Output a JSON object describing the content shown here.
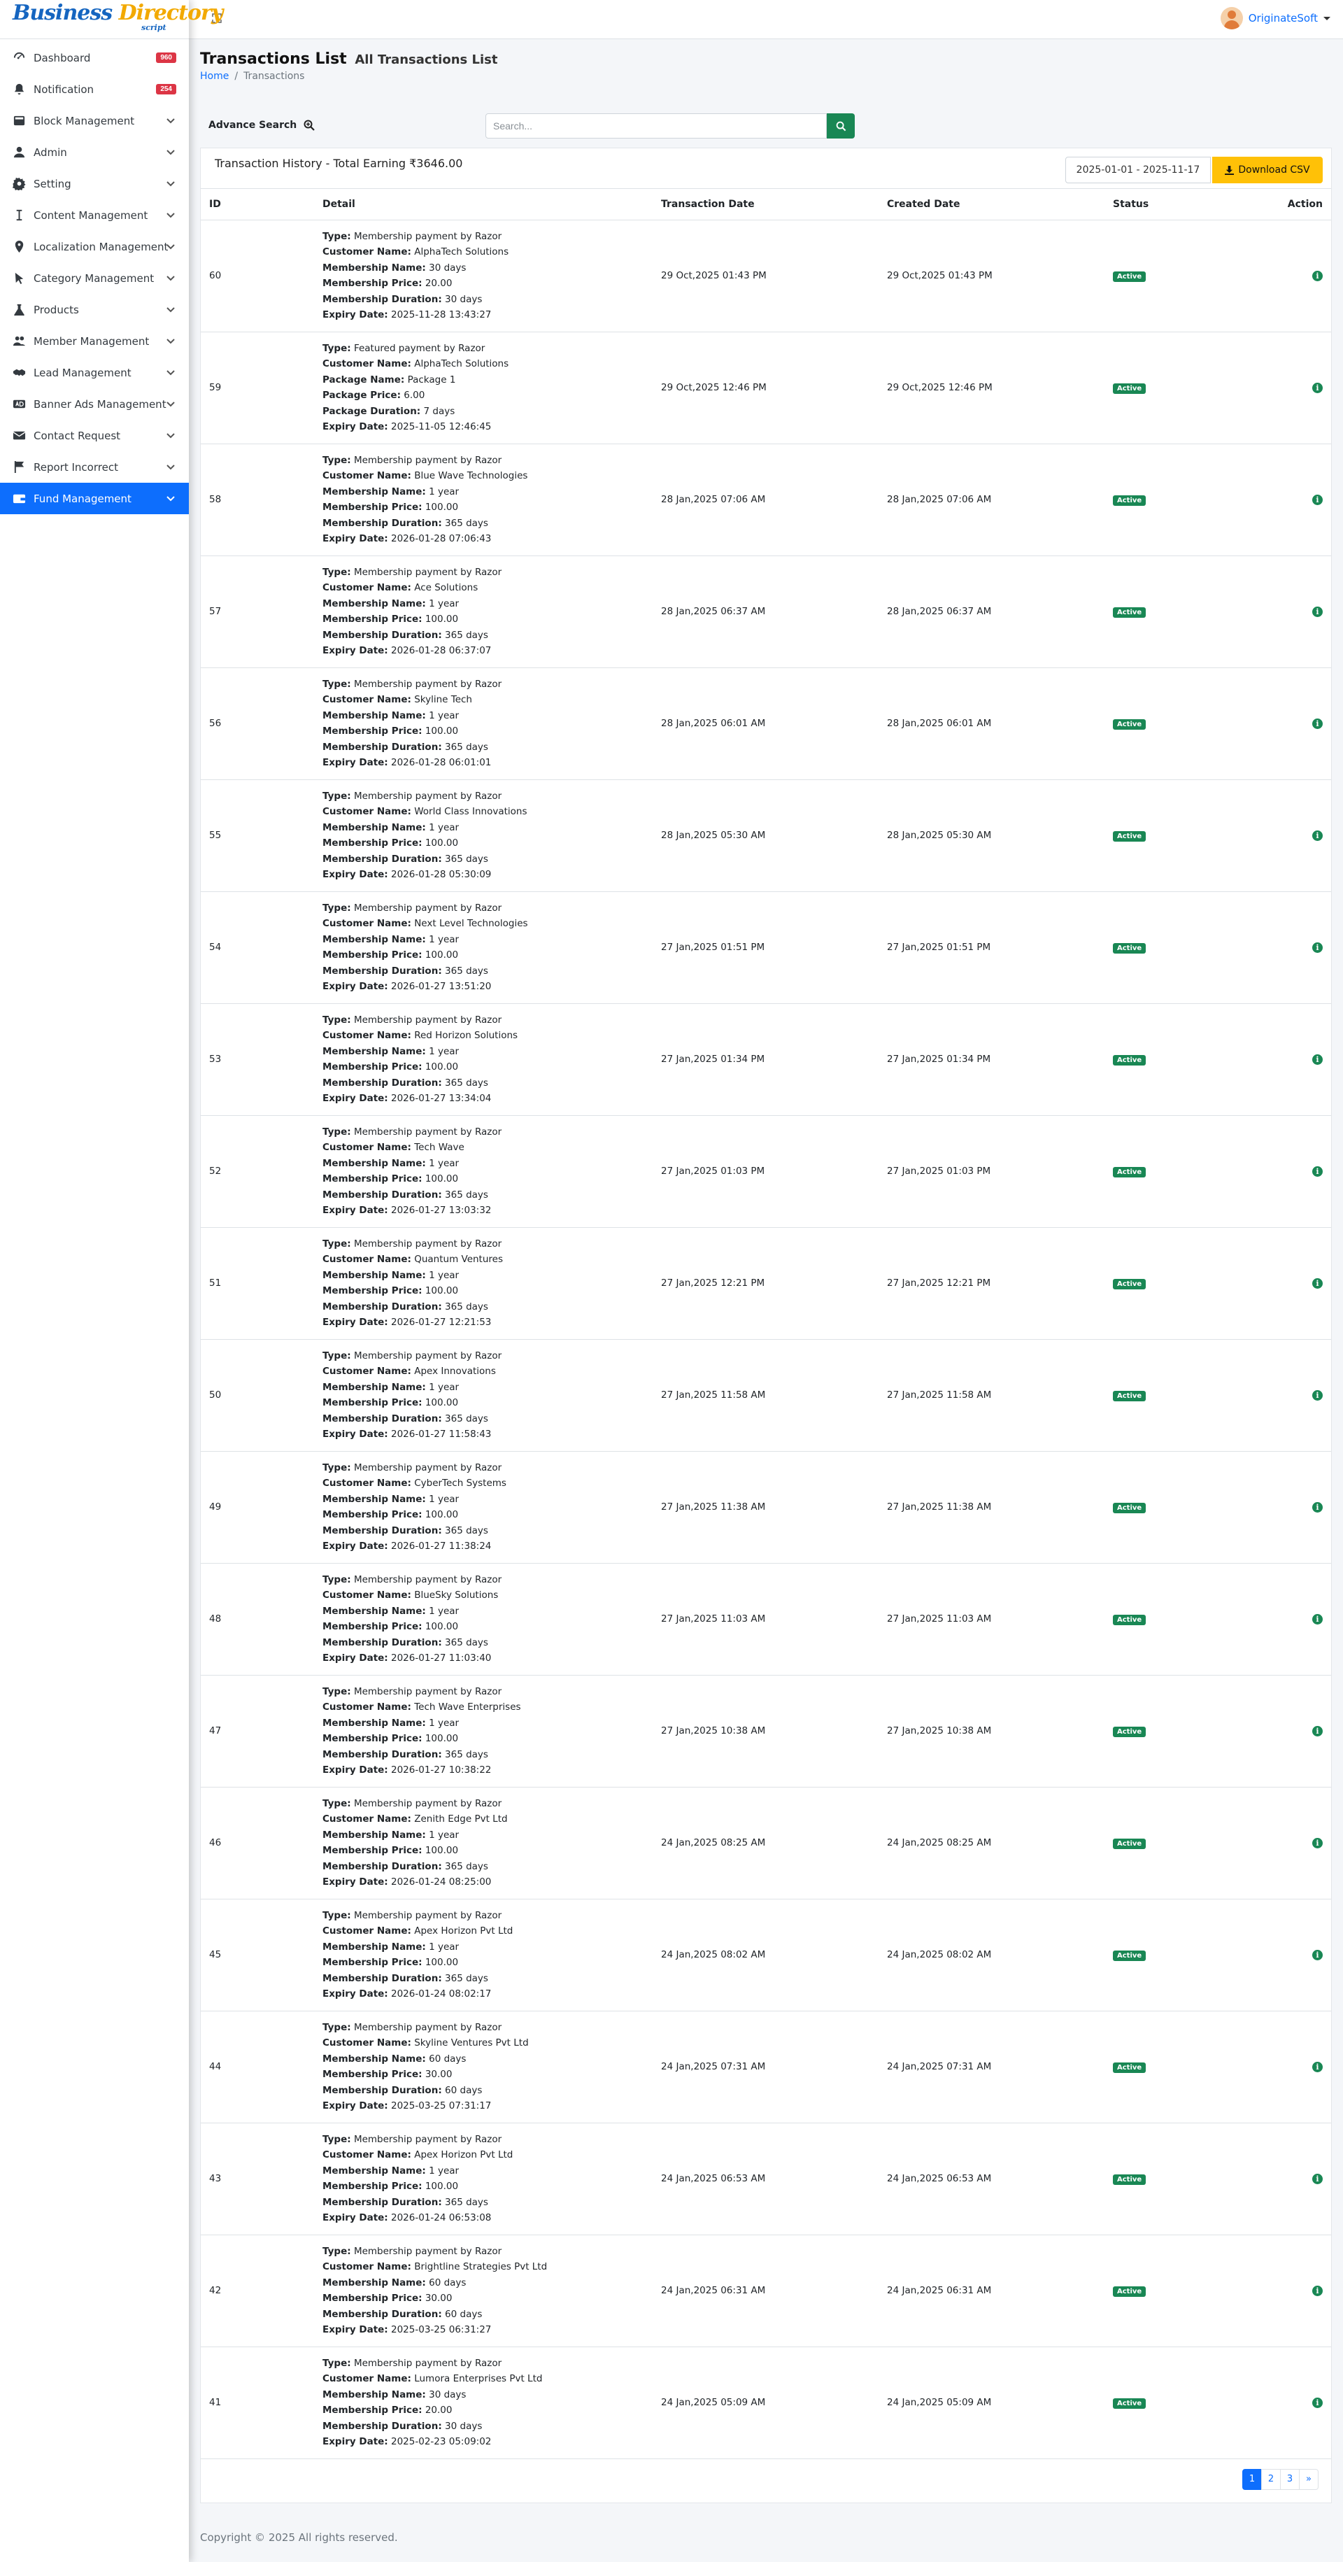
{
  "brand": {
    "word1": "Business",
    "word2": "Directory",
    "tag": "script"
  },
  "sidebar": {
    "items": [
      {
        "label": "Dashboard",
        "icon": "dashboard-icon",
        "badge": "960"
      },
      {
        "label": "Notification",
        "icon": "bell-icon",
        "badge": "254"
      },
      {
        "label": "Block Management",
        "icon": "block-icon"
      },
      {
        "label": "Admin",
        "icon": "user-icon"
      },
      {
        "label": "Setting",
        "icon": "gear-icon"
      },
      {
        "label": "Content Management",
        "icon": "text-cursor-icon"
      },
      {
        "label": "Localization Management",
        "icon": "map-pin-icon"
      },
      {
        "label": "Category Management",
        "icon": "cursor-icon"
      },
      {
        "label": "Products",
        "icon": "flask-icon"
      },
      {
        "label": "Member Management",
        "icon": "users-icon"
      },
      {
        "label": "Lead Management",
        "icon": "handshake-icon"
      },
      {
        "label": "Banner Ads Management",
        "icon": "ad-icon"
      },
      {
        "label": "Contact Request",
        "icon": "envelope-icon"
      },
      {
        "label": "Report Incorrect",
        "icon": "flag-icon"
      },
      {
        "label": "Fund Management",
        "icon": "wallet-icon",
        "active": true
      }
    ]
  },
  "topbar": {
    "username": "OriginateSoft"
  },
  "page": {
    "title": "Transactions List",
    "subtitle": "All Transactions List",
    "crumb_home": "Home",
    "crumb_sep": "/",
    "crumb_current": "Transactions"
  },
  "search": {
    "advance_label": "Advance Search",
    "placeholder": "Search..."
  },
  "card": {
    "heading": "Transaction History - Total Earning ₹3646.00",
    "date_range": "2025-01-01 - 2025-11-17",
    "download_label": "Download CSV"
  },
  "table": {
    "headers": [
      "ID",
      "Detail",
      "Transaction Date",
      "Created Date",
      "Status",
      "Action"
    ],
    "rows": [
      {
        "id": "60",
        "lines": [
          [
            "Type:",
            "Membership payment by Razor"
          ],
          [
            "Customer Name:",
            "AlphaTech Solutions"
          ],
          [
            "Membership Name:",
            "30 days"
          ],
          [
            "Membership Price:",
            "20.00"
          ],
          [
            "Membership Duration:",
            "30 days"
          ],
          [
            "Expiry Date:",
            "2025-11-28 13:43:27"
          ]
        ],
        "txn": "29 Oct,2025 01:43 PM",
        "created": "29 Oct,2025 01:43 PM",
        "status": "Active"
      },
      {
        "id": "59",
        "lines": [
          [
            "Type:",
            "Featured payment by Razor"
          ],
          [
            "Customer Name:",
            "AlphaTech Solutions"
          ],
          [
            "Package Name:",
            "Package 1"
          ],
          [
            "Package Price:",
            "6.00"
          ],
          [
            "Package Duration:",
            "7 days"
          ],
          [
            "Expiry Date:",
            "2025-11-05 12:46:45"
          ]
        ],
        "txn": "29 Oct,2025 12:46 PM",
        "created": "29 Oct,2025 12:46 PM",
        "status": "Active"
      },
      {
        "id": "58",
        "lines": [
          [
            "Type:",
            "Membership payment by Razor"
          ],
          [
            "Customer Name:",
            "Blue Wave Technologies"
          ],
          [
            "Membership Name:",
            "1 year"
          ],
          [
            "Membership Price:",
            "100.00"
          ],
          [
            "Membership Duration:",
            "365 days"
          ],
          [
            "Expiry Date:",
            "2026-01-28 07:06:43"
          ]
        ],
        "txn": "28 Jan,2025 07:06 AM",
        "created": "28 Jan,2025 07:06 AM",
        "status": "Active"
      },
      {
        "id": "57",
        "lines": [
          [
            "Type:",
            "Membership payment by Razor"
          ],
          [
            "Customer Name:",
            "Ace Solutions"
          ],
          [
            "Membership Name:",
            "1 year"
          ],
          [
            "Membership Price:",
            "100.00"
          ],
          [
            "Membership Duration:",
            "365 days"
          ],
          [
            "Expiry Date:",
            "2026-01-28 06:37:07"
          ]
        ],
        "txn": "28 Jan,2025 06:37 AM",
        "created": "28 Jan,2025 06:37 AM",
        "status": "Active"
      },
      {
        "id": "56",
        "lines": [
          [
            "Type:",
            "Membership payment by Razor"
          ],
          [
            "Customer Name:",
            "Skyline Tech"
          ],
          [
            "Membership Name:",
            "1 year"
          ],
          [
            "Membership Price:",
            "100.00"
          ],
          [
            "Membership Duration:",
            "365 days"
          ],
          [
            "Expiry Date:",
            "2026-01-28 06:01:01"
          ]
        ],
        "txn": "28 Jan,2025 06:01 AM",
        "created": "28 Jan,2025 06:01 AM",
        "status": "Active"
      },
      {
        "id": "55",
        "lines": [
          [
            "Type:",
            "Membership payment by Razor"
          ],
          [
            "Customer Name:",
            "World Class Innovations"
          ],
          [
            "Membership Name:",
            "1 year"
          ],
          [
            "Membership Price:",
            "100.00"
          ],
          [
            "Membership Duration:",
            "365 days"
          ],
          [
            "Expiry Date:",
            "2026-01-28 05:30:09"
          ]
        ],
        "txn": "28 Jan,2025 05:30 AM",
        "created": "28 Jan,2025 05:30 AM",
        "status": "Active"
      },
      {
        "id": "54",
        "lines": [
          [
            "Type:",
            "Membership payment by Razor"
          ],
          [
            "Customer Name:",
            "Next Level Technologies"
          ],
          [
            "Membership Name:",
            "1 year"
          ],
          [
            "Membership Price:",
            "100.00"
          ],
          [
            "Membership Duration:",
            "365 days"
          ],
          [
            "Expiry Date:",
            "2026-01-27 13:51:20"
          ]
        ],
        "txn": "27 Jan,2025 01:51 PM",
        "created": "27 Jan,2025 01:51 PM",
        "status": "Active"
      },
      {
        "id": "53",
        "lines": [
          [
            "Type:",
            "Membership payment by Razor"
          ],
          [
            "Customer Name:",
            "Red Horizon Solutions"
          ],
          [
            "Membership Name:",
            "1 year"
          ],
          [
            "Membership Price:",
            "100.00"
          ],
          [
            "Membership Duration:",
            "365 days"
          ],
          [
            "Expiry Date:",
            "2026-01-27 13:34:04"
          ]
        ],
        "txn": "27 Jan,2025 01:34 PM",
        "created": "27 Jan,2025 01:34 PM",
        "status": "Active"
      },
      {
        "id": "52",
        "lines": [
          [
            "Type:",
            "Membership payment by Razor"
          ],
          [
            "Customer Name:",
            "Tech Wave"
          ],
          [
            "Membership Name:",
            "1 year"
          ],
          [
            "Membership Price:",
            "100.00"
          ],
          [
            "Membership Duration:",
            "365 days"
          ],
          [
            "Expiry Date:",
            "2026-01-27 13:03:32"
          ]
        ],
        "txn": "27 Jan,2025 01:03 PM",
        "created": "27 Jan,2025 01:03 PM",
        "status": "Active"
      },
      {
        "id": "51",
        "lines": [
          [
            "Type:",
            "Membership payment by Razor"
          ],
          [
            "Customer Name:",
            "Quantum Ventures"
          ],
          [
            "Membership Name:",
            "1 year"
          ],
          [
            "Membership Price:",
            "100.00"
          ],
          [
            "Membership Duration:",
            "365 days"
          ],
          [
            "Expiry Date:",
            "2026-01-27 12:21:53"
          ]
        ],
        "txn": "27 Jan,2025 12:21 PM",
        "created": "27 Jan,2025 12:21 PM",
        "status": "Active"
      },
      {
        "id": "50",
        "lines": [
          [
            "Type:",
            "Membership payment by Razor"
          ],
          [
            "Customer Name:",
            "Apex Innovations"
          ],
          [
            "Membership Name:",
            "1 year"
          ],
          [
            "Membership Price:",
            "100.00"
          ],
          [
            "Membership Duration:",
            "365 days"
          ],
          [
            "Expiry Date:",
            "2026-01-27 11:58:43"
          ]
        ],
        "txn": "27 Jan,2025 11:58 AM",
        "created": "27 Jan,2025 11:58 AM",
        "status": "Active"
      },
      {
        "id": "49",
        "lines": [
          [
            "Type:",
            "Membership payment by Razor"
          ],
          [
            "Customer Name:",
            "CyberTech Systems"
          ],
          [
            "Membership Name:",
            "1 year"
          ],
          [
            "Membership Price:",
            "100.00"
          ],
          [
            "Membership Duration:",
            "365 days"
          ],
          [
            "Expiry Date:",
            "2026-01-27 11:38:24"
          ]
        ],
        "txn": "27 Jan,2025 11:38 AM",
        "created": "27 Jan,2025 11:38 AM",
        "status": "Active"
      },
      {
        "id": "48",
        "lines": [
          [
            "Type:",
            "Membership payment by Razor"
          ],
          [
            "Customer Name:",
            "BlueSky Solutions"
          ],
          [
            "Membership Name:",
            "1 year"
          ],
          [
            "Membership Price:",
            "100.00"
          ],
          [
            "Membership Duration:",
            "365 days"
          ],
          [
            "Expiry Date:",
            "2026-01-27 11:03:40"
          ]
        ],
        "txn": "27 Jan,2025 11:03 AM",
        "created": "27 Jan,2025 11:03 AM",
        "status": "Active"
      },
      {
        "id": "47",
        "lines": [
          [
            "Type:",
            "Membership payment by Razor"
          ],
          [
            "Customer Name:",
            "Tech Wave Enterprises"
          ],
          [
            "Membership Name:",
            "1 year"
          ],
          [
            "Membership Price:",
            "100.00"
          ],
          [
            "Membership Duration:",
            "365 days"
          ],
          [
            "Expiry Date:",
            "2026-01-27 10:38:22"
          ]
        ],
        "txn": "27 Jan,2025 10:38 AM",
        "created": "27 Jan,2025 10:38 AM",
        "status": "Active"
      },
      {
        "id": "46",
        "lines": [
          [
            "Type:",
            "Membership payment by Razor"
          ],
          [
            "Customer Name:",
            "Zenith Edge Pvt Ltd"
          ],
          [
            "Membership Name:",
            "1 year"
          ],
          [
            "Membership Price:",
            "100.00"
          ],
          [
            "Membership Duration:",
            "365 days"
          ],
          [
            "Expiry Date:",
            "2026-01-24 08:25:00"
          ]
        ],
        "txn": "24 Jan,2025 08:25 AM",
        "created": "24 Jan,2025 08:25 AM",
        "status": "Active"
      },
      {
        "id": "45",
        "lines": [
          [
            "Type:",
            "Membership payment by Razor"
          ],
          [
            "Customer Name:",
            "Apex Horizon Pvt Ltd"
          ],
          [
            "Membership Name:",
            "1 year"
          ],
          [
            "Membership Price:",
            "100.00"
          ],
          [
            "Membership Duration:",
            "365 days"
          ],
          [
            "Expiry Date:",
            "2026-01-24 08:02:17"
          ]
        ],
        "txn": "24 Jan,2025 08:02 AM",
        "created": "24 Jan,2025 08:02 AM",
        "status": "Active"
      },
      {
        "id": "44",
        "lines": [
          [
            "Type:",
            "Membership payment by Razor"
          ],
          [
            "Customer Name:",
            "Skyline Ventures Pvt Ltd"
          ],
          [
            "Membership Name:",
            "60 days"
          ],
          [
            "Membership Price:",
            "30.00"
          ],
          [
            "Membership Duration:",
            "60 days"
          ],
          [
            "Expiry Date:",
            "2025-03-25 07:31:17"
          ]
        ],
        "txn": "24 Jan,2025 07:31 AM",
        "created": "24 Jan,2025 07:31 AM",
        "status": "Active"
      },
      {
        "id": "43",
        "lines": [
          [
            "Type:",
            "Membership payment by Razor"
          ],
          [
            "Customer Name:",
            "Apex Horizon Pvt Ltd"
          ],
          [
            "Membership Name:",
            "1 year"
          ],
          [
            "Membership Price:",
            "100.00"
          ],
          [
            "Membership Duration:",
            "365 days"
          ],
          [
            "Expiry Date:",
            "2026-01-24 06:53:08"
          ]
        ],
        "txn": "24 Jan,2025 06:53 AM",
        "created": "24 Jan,2025 06:53 AM",
        "status": "Active"
      },
      {
        "id": "42",
        "lines": [
          [
            "Type:",
            "Membership payment by Razor"
          ],
          [
            "Customer Name:",
            "Brightline Strategies Pvt Ltd"
          ],
          [
            "Membership Name:",
            "60 days"
          ],
          [
            "Membership Price:",
            "30.00"
          ],
          [
            "Membership Duration:",
            "60 days"
          ],
          [
            "Expiry Date:",
            "2025-03-25 06:31:27"
          ]
        ],
        "txn": "24 Jan,2025 06:31 AM",
        "created": "24 Jan,2025 06:31 AM",
        "status": "Active"
      },
      {
        "id": "41",
        "lines": [
          [
            "Type:",
            "Membership payment by Razor"
          ],
          [
            "Customer Name:",
            "Lumora Enterprises Pvt Ltd"
          ],
          [
            "Membership Name:",
            "30 days"
          ],
          [
            "Membership Price:",
            "20.00"
          ],
          [
            "Membership Duration:",
            "30 days"
          ],
          [
            "Expiry Date:",
            "2025-02-23 05:09:02"
          ]
        ],
        "txn": "24 Jan,2025 05:09 AM",
        "created": "24 Jan,2025 05:09 AM",
        "status": "Active"
      }
    ]
  },
  "pagination": {
    "pages": [
      "1",
      "2",
      "3"
    ],
    "next": "»",
    "current": "1"
  },
  "footer": {
    "text": "Copyright © 2025 All rights reserved."
  },
  "colors": {
    "primary": "#0d6efd",
    "success": "#198754",
    "danger": "#dc3545",
    "warning": "#ffc107"
  }
}
